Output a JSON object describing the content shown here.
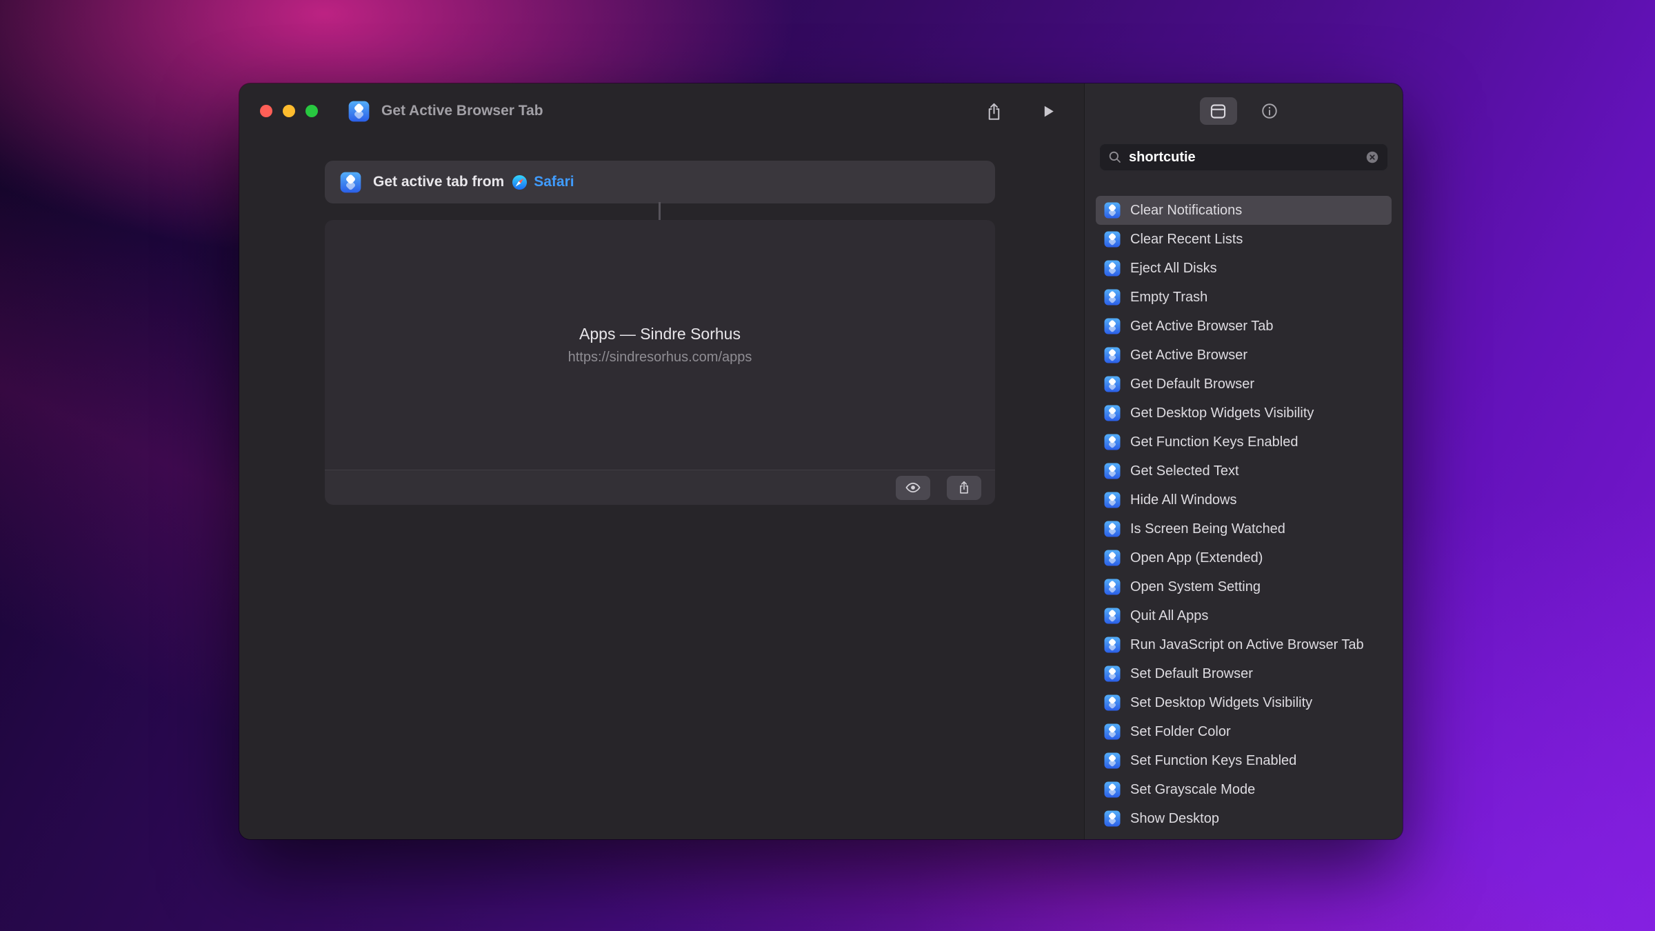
{
  "window": {
    "title": "Get Active Browser Tab"
  },
  "colors": {
    "traffic_red": "#ff5f57",
    "traffic_yellow": "#febc2e",
    "traffic_green": "#28c840",
    "accent_blue": "#409cff",
    "shortcuts_blue_top": "#54aef8",
    "shortcuts_blue_bottom": "#2b5fe8"
  },
  "toolbar": {
    "share_icon": "square-and-arrow-up",
    "run_icon": "play"
  },
  "canvas": {
    "action_card": {
      "text_prefix": "Get active tab from",
      "app_name": "Safari"
    },
    "result_card": {
      "title": "Apps — Sindre Sorhus",
      "url": "https://sindresorhus.com/apps"
    }
  },
  "sidebar": {
    "tabs": [
      {
        "name": "action-library",
        "selected": true
      },
      {
        "name": "info",
        "selected": false
      }
    ],
    "search": {
      "value": "shortcutie"
    },
    "selected_index": 0,
    "items": [
      "Clear Notifications",
      "Clear Recent Lists",
      "Eject All Disks",
      "Empty Trash",
      "Get Active Browser Tab",
      "Get Active Browser",
      "Get Default Browser",
      "Get Desktop Widgets Visibility",
      "Get Function Keys Enabled",
      "Get Selected Text",
      "Hide All Windows",
      "Is Screen Being Watched",
      "Open App (Extended)",
      "Open System Setting",
      "Quit All Apps",
      "Run JavaScript on Active Browser Tab",
      "Set Default Browser",
      "Set Desktop Widgets Visibility",
      "Set Folder Color",
      "Set Function Keys Enabled",
      "Set Grayscale Mode",
      "Show Desktop"
    ]
  }
}
